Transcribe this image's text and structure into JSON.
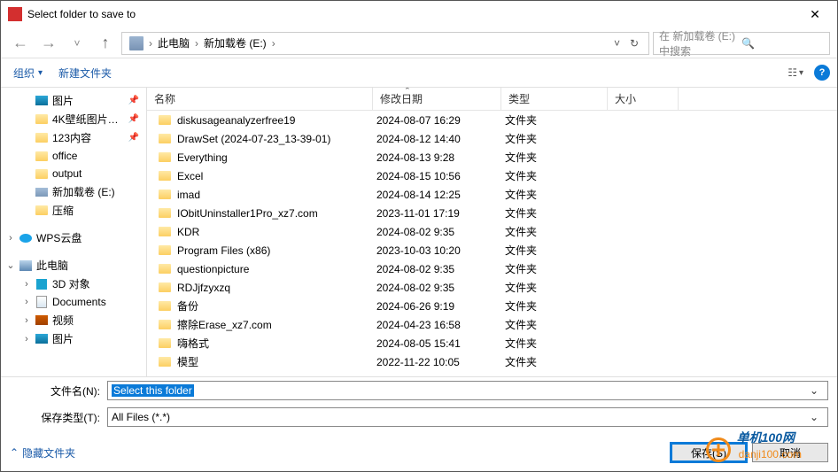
{
  "title": "Select folder to save to",
  "breadcrumb": {
    "pc": "此电脑",
    "drive": "新加载卷 (E:)"
  },
  "search": {
    "placeholder": "在 新加载卷 (E:) 中搜索"
  },
  "toolbar": {
    "organize": "组织",
    "newfolder": "新建文件夹"
  },
  "sidebar": {
    "items": [
      {
        "label": "图片",
        "type": "pic",
        "pin": true,
        "indent": 1
      },
      {
        "label": "4K壁纸图片…",
        "type": "fld",
        "pin": true,
        "indent": 1
      },
      {
        "label": "123内容",
        "type": "fld",
        "pin": true,
        "indent": 1
      },
      {
        "label": "office",
        "type": "fld",
        "indent": 1
      },
      {
        "label": "output",
        "type": "fld",
        "indent": 1
      },
      {
        "label": "新加载卷 (E:)",
        "type": "drv",
        "indent": 1
      },
      {
        "label": "压缩",
        "type": "fld",
        "indent": 1
      },
      {
        "label": "",
        "type": "gap"
      },
      {
        "label": "WPS云盘",
        "type": "cloud",
        "exp": ">",
        "indent": 0
      },
      {
        "label": "",
        "type": "gap"
      },
      {
        "label": "此电脑",
        "type": "pc",
        "exp": "v",
        "indent": 0
      },
      {
        "label": "3D 对象",
        "type": "box3d",
        "exp": ">",
        "indent": 1
      },
      {
        "label": "Documents",
        "type": "doc",
        "exp": ">",
        "indent": 1
      },
      {
        "label": "视频",
        "type": "vid",
        "exp": ">",
        "indent": 1
      },
      {
        "label": "图片",
        "type": "pic",
        "exp": ">",
        "indent": 1
      }
    ]
  },
  "columns": {
    "name": "名称",
    "date": "修改日期",
    "type": "类型",
    "size": "大小"
  },
  "type_folder": "文件夹",
  "rows": [
    {
      "n": "diskusageanalyzerfree19",
      "d": "2024-08-07 16:29"
    },
    {
      "n": "DrawSet (2024-07-23_13-39-01)",
      "d": "2024-08-12 14:40"
    },
    {
      "n": "Everything",
      "d": "2024-08-13 9:28"
    },
    {
      "n": "Excel",
      "d": "2024-08-15 10:56"
    },
    {
      "n": "imad",
      "d": "2024-08-14 12:25"
    },
    {
      "n": "IObitUninstaller1Pro_xz7.com",
      "d": "2023-11-01 17:19"
    },
    {
      "n": "KDR",
      "d": "2024-08-02 9:35"
    },
    {
      "n": "Program Files (x86)",
      "d": "2023-10-03 10:20"
    },
    {
      "n": "questionpicture",
      "d": "2024-08-02 9:35"
    },
    {
      "n": "RDJjfzyxzq",
      "d": "2024-08-02 9:35"
    },
    {
      "n": "备份",
      "d": "2024-06-26 9:19"
    },
    {
      "n": "擦除Erase_xz7.com",
      "d": "2024-04-23 16:58"
    },
    {
      "n": "嗨格式",
      "d": "2024-08-05 15:41"
    },
    {
      "n": "模型",
      "d": "2022-11-22 10:05"
    }
  ],
  "filename": {
    "label": "文件名(N):",
    "value": "Select this folder"
  },
  "filetype": {
    "label": "保存类型(T):",
    "value": "All Files (*.*)"
  },
  "footer": {
    "hide": "隐藏文件夹",
    "save": "保存(S)",
    "cancel": "取消"
  },
  "watermark": {
    "t1": "单机100网",
    "t2": "danji100.com"
  }
}
